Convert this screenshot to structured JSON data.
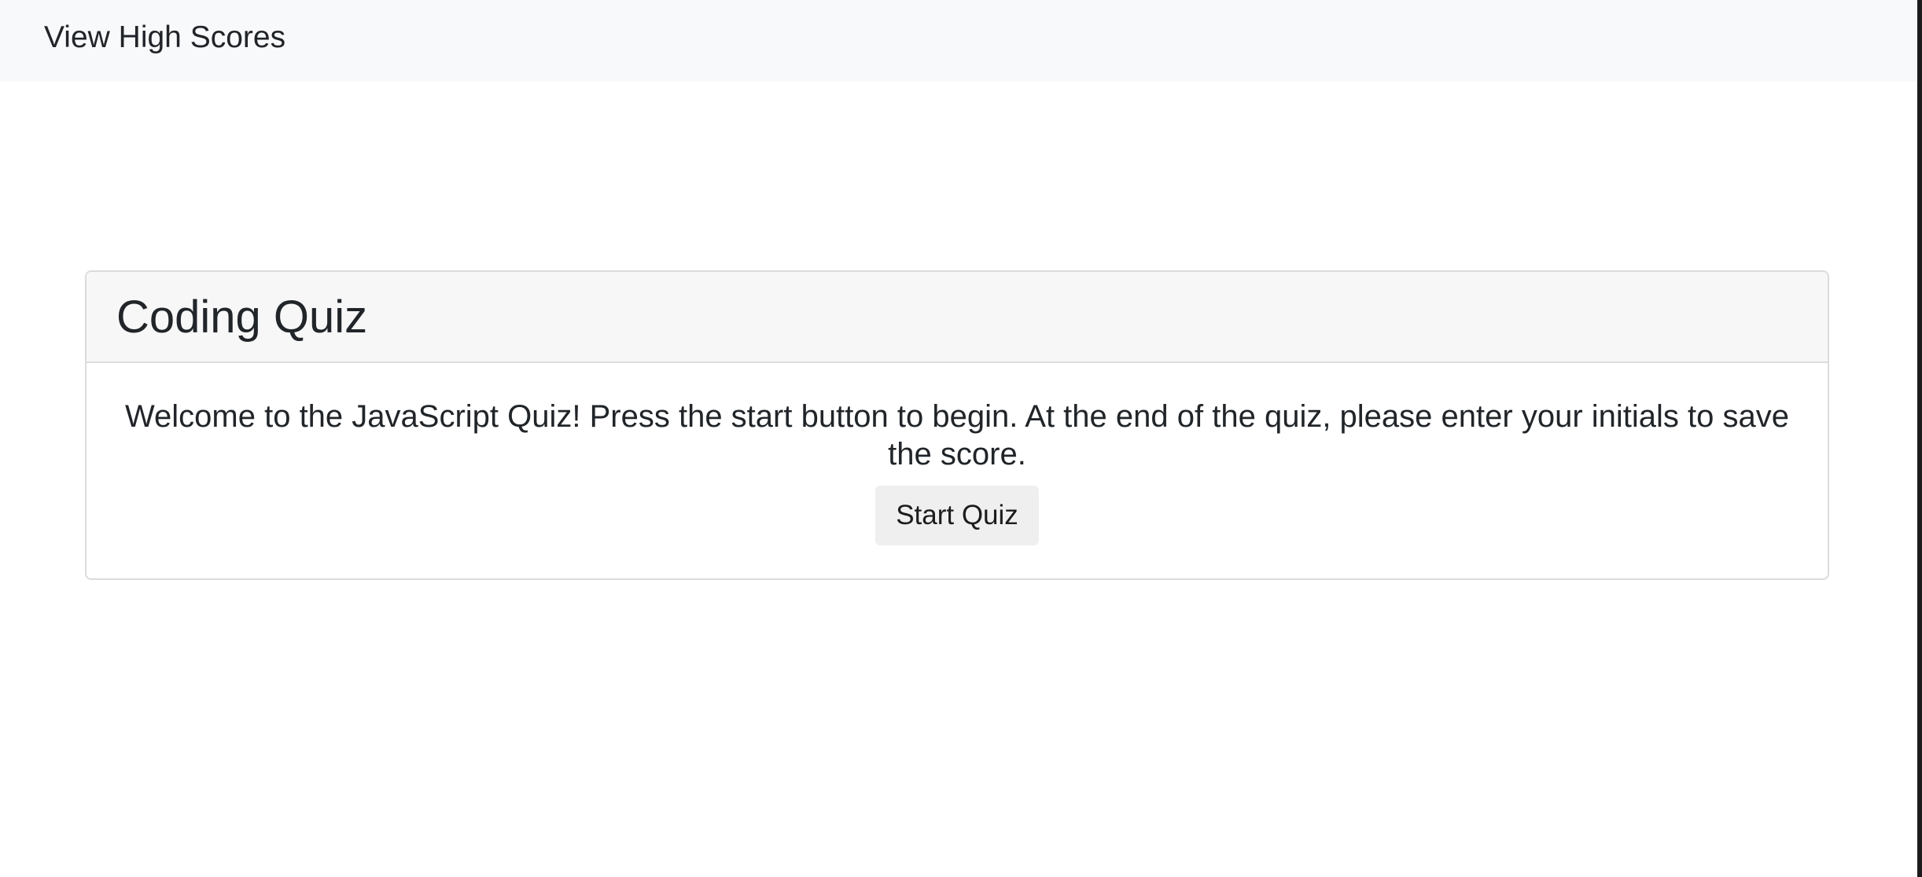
{
  "navbar": {
    "high_scores_link": "View High Scores"
  },
  "quiz_card": {
    "title": "Coding Quiz",
    "intro": "Welcome to the JavaScript Quiz! Press the start button to begin. At the end of the quiz, please enter your initials to save the score.",
    "start_button": "Start Quiz"
  },
  "colors": {
    "navbar_bg": "#f8f9fa",
    "card_header_bg": "#f7f7f7",
    "button_bg": "#efefef",
    "text": "#212529"
  }
}
